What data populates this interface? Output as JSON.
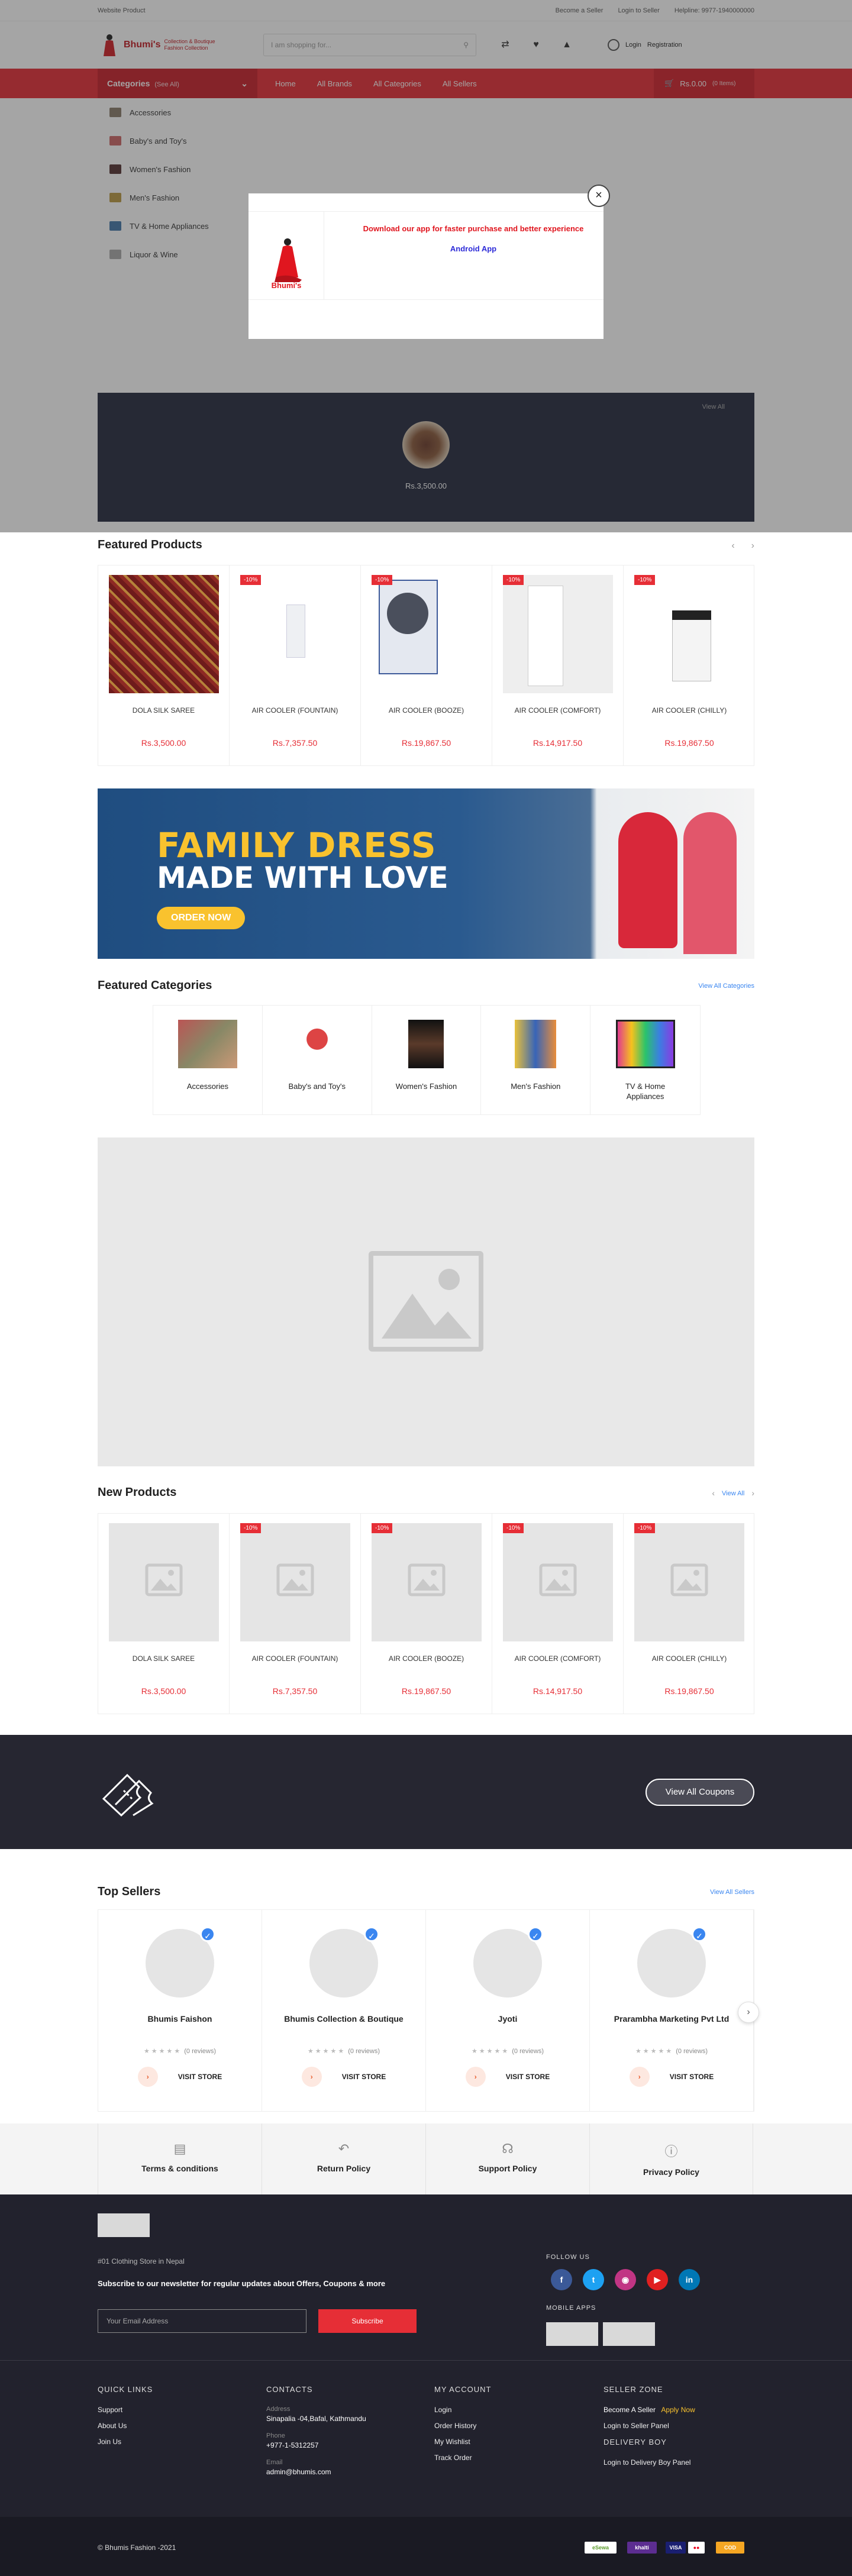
{
  "topbar": {
    "left": "Website Product",
    "become_seller": "Become a Seller",
    "login_seller": "Login to Seller",
    "helpline": "Helpline: 9977-1940000000"
  },
  "header": {
    "brand": "Bhumi's",
    "tagline": "Collection & Boutique Fashion Collection",
    "search_placeholder": "I am shopping for...",
    "login": "Login",
    "register": "Registration"
  },
  "nav": {
    "categories_label": "Categories",
    "see_all": "(See All)",
    "links": [
      "Home",
      "All Brands",
      "All Categories",
      "All Sellers"
    ],
    "cart_total": "Rs.0.00",
    "cart_items": "(0 Items)"
  },
  "categories": [
    "Accessories",
    "Baby's and Toy's",
    "Women's Fashion",
    "Men's Fashion",
    "TV & Home Appliances",
    "Liquor & Wine"
  ],
  "modal": {
    "message": "Download our app for faster purchase and better experience",
    "app_link": "Android App",
    "logo_text": "Bhumi's"
  },
  "deal": {
    "view_all": "View All",
    "price": "Rs.3,500.00"
  },
  "featured_products": {
    "title": "Featured Products",
    "items": [
      {
        "name": "DOLA SILK SAREE",
        "price": "Rs.3,500.00",
        "discount": ""
      },
      {
        "name": "AIR COOLER (FOUNTAIN)",
        "price": "Rs.7,357.50",
        "discount": "-10%"
      },
      {
        "name": "AIR COOLER (BOOZE)",
        "price": "Rs.19,867.50",
        "discount": "-10%"
      },
      {
        "name": "AIR COOLER (COMFORT)",
        "price": "Rs.14,917.50",
        "discount": "-10%"
      },
      {
        "name": "AIR COOLER (CHILLY)",
        "price": "Rs.19,867.50",
        "discount": "-10%"
      }
    ]
  },
  "banner": {
    "line1": "FAMILY DRESS",
    "line2": "MADE WITH LOVE",
    "cta": "ORDER NOW"
  },
  "featured_categories": {
    "title": "Featured Categories",
    "view_all": "View All Categories",
    "items": [
      "Accessories",
      "Baby's and Toy's",
      "Women's Fashion",
      "Men's Fashion",
      "TV & Home Appliances"
    ]
  },
  "new_products": {
    "title": "New Products",
    "view_all": "View All",
    "items": [
      {
        "name": "DOLA SILK SAREE",
        "price": "Rs.3,500.00",
        "discount": ""
      },
      {
        "name": "AIR COOLER (FOUNTAIN)",
        "price": "Rs.7,357.50",
        "discount": "-10%"
      },
      {
        "name": "AIR COOLER (BOOZE)",
        "price": "Rs.19,867.50",
        "discount": "-10%"
      },
      {
        "name": "AIR COOLER (COMFORT)",
        "price": "Rs.14,917.50",
        "discount": "-10%"
      },
      {
        "name": "AIR COOLER (CHILLY)",
        "price": "Rs.19,867.50",
        "discount": "-10%"
      }
    ]
  },
  "coupons": {
    "button": "View All Coupons"
  },
  "top_sellers": {
    "title": "Top Sellers",
    "view_all": "View All Sellers",
    "visit": "VISIT STORE",
    "items": [
      {
        "name": "Bhumis Faishon",
        "reviews": "(0 reviews)"
      },
      {
        "name": "Bhumis Collection & Boutique",
        "reviews": "(0 reviews)"
      },
      {
        "name": "Jyoti",
        "reviews": "(0 reviews)"
      },
      {
        "name": "Prarambha Marketing Pvt Ltd",
        "reviews": "(0 reviews)"
      }
    ]
  },
  "policies": [
    "Terms & conditions",
    "Return Policy",
    "Support Policy",
    "Privacy Policy"
  ],
  "footer": {
    "tagline": "#01 Clothing Store in Nepal",
    "newsletter": "Subscribe to our newsletter for regular updates about Offers, Coupons & more",
    "email_placeholder": "Your Email Address",
    "subscribe": "Subscribe",
    "follow_us": "FOLLOW US",
    "mobile_apps": "MOBILE APPS",
    "quick_links": {
      "title": "QUICK LINKS",
      "items": [
        "Support",
        "About Us",
        "Join Us"
      ]
    },
    "contacts": {
      "title": "CONTACTS",
      "address_label": "Address",
      "address": "Sinapalia -04,Bafal, Kathmandu",
      "phone_label": "Phone",
      "phone": "+977-1-5312257",
      "email_label": "Email",
      "email": "admin@bhumis.com"
    },
    "my_account": {
      "title": "MY ACCOUNT",
      "items": [
        "Login",
        "Order History",
        "My Wishlist",
        "Track Order"
      ]
    },
    "seller_zone": {
      "title": "SELLER ZONE",
      "become": "Become A Seller",
      "apply": "Apply Now",
      "login": "Login to Seller Panel",
      "delivery_title": "DELIVERY BOY",
      "delivery_login": "Login to Delivery Boy Panel"
    },
    "copyright": "© Bhumis Fashion -2021"
  },
  "colors": {
    "primary": "#e62e36",
    "dark": "#22222d",
    "accent": "#f9c22e"
  }
}
